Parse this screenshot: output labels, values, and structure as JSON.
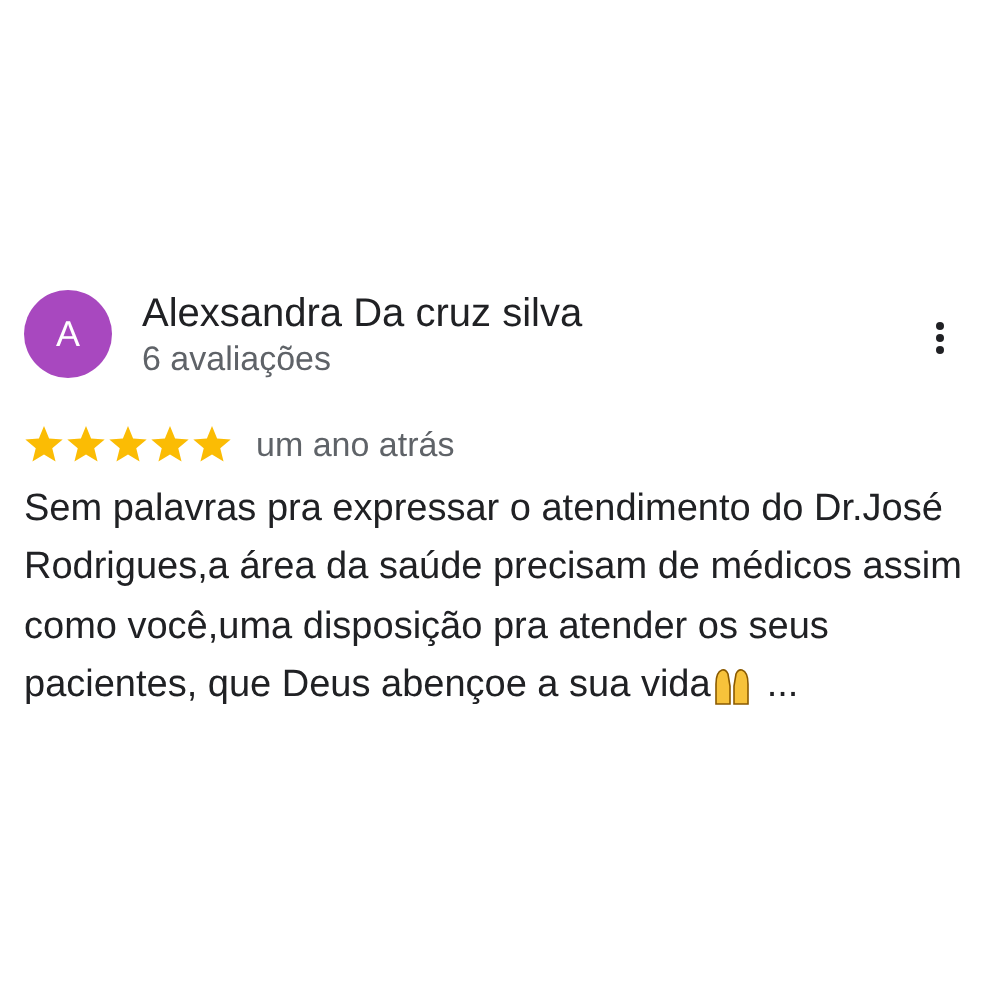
{
  "review": {
    "avatar_letter": "A",
    "author": "Alexsandra Da cruz silva",
    "reviews_count": "6 avaliações",
    "stars": 5,
    "time": "um ano atrás",
    "text_lines": [
      "Sem palavras pra expressar o atendimento do Dr.José",
      "Rodrigues,a área da saúde precisam de médicos assim",
      "como você,uma disposição pra atender os seus",
      "pacientes, que Deus abençoe a sua vida"
    ],
    "more": "..."
  }
}
